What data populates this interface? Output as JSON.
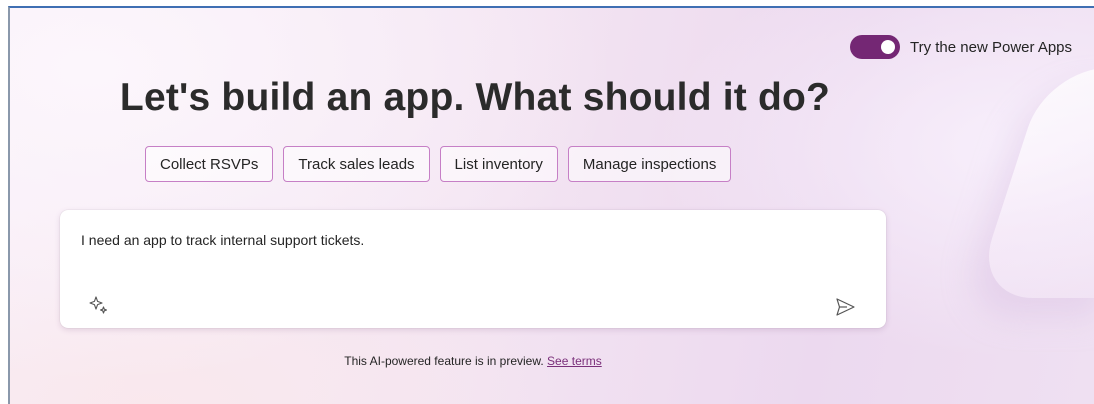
{
  "toggle": {
    "label": "Try the new Power Apps",
    "state": "on",
    "color": "#742774"
  },
  "headline": "Let's build an app. What should it do?",
  "suggestions": [
    "Collect RSVPs",
    "Track sales leads",
    "List inventory",
    "Manage inspections"
  ],
  "prompt": {
    "value": "I need an app to track internal support tickets.",
    "left_icon": "sparkle-icon",
    "right_icon": "send-icon"
  },
  "footer": {
    "text": "This AI-powered feature is in preview.",
    "link": "See terms"
  },
  "colors": {
    "accent": "#742774",
    "chip_border": "#c67fc6",
    "link": "#7a2f7a"
  }
}
